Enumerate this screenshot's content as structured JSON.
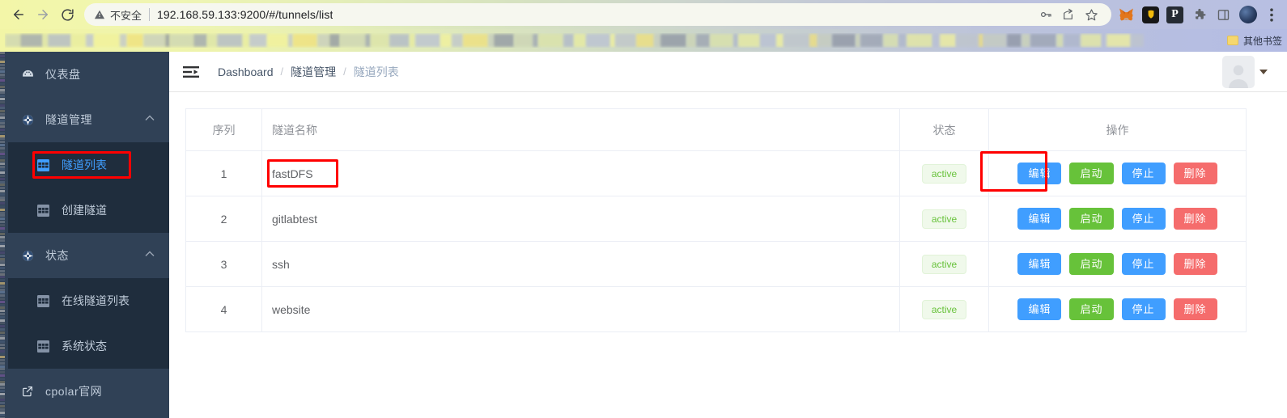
{
  "browser": {
    "back_icon": "back-arrow-icon",
    "forward_icon": "forward-arrow-icon",
    "reload_icon": "reload-icon",
    "security_label": "不安全",
    "warning_icon": "warning-triangle-icon",
    "url": "192.168.59.133:9200/#/tunnels/list",
    "omnibox_icons": [
      "key-icon",
      "share-icon",
      "bookmark-star-icon"
    ],
    "extensions": [
      {
        "name": "metamask-extension-icon",
        "glyph": "🦊"
      },
      {
        "name": "binance-wallet-extension-icon",
        "glyph": "🦁"
      },
      {
        "name": "pocket-extension-icon",
        "glyph": "P"
      },
      {
        "name": "extensions-puzzle-icon",
        "glyph": "puzzle"
      },
      {
        "name": "side-panel-icon",
        "glyph": "panel"
      },
      {
        "name": "profile-avatar-icon",
        "glyph": "avatar"
      },
      {
        "name": "chrome-menu-icon",
        "glyph": "⋮"
      }
    ],
    "other_bookmarks_label": "其他书签"
  },
  "sidebar": {
    "items": [
      {
        "label": "仪表盘",
        "icon": "dashboard-gauge-icon",
        "type": "item"
      },
      {
        "label": "隧道管理",
        "icon": "compass-icon",
        "type": "group",
        "arrow": "chevron-up-icon",
        "children": [
          {
            "label": "隧道列表",
            "icon": "grid-table-icon",
            "active": true,
            "annotated": true
          },
          {
            "label": "创建隧道",
            "icon": "grid-table-icon",
            "active": false
          }
        ]
      },
      {
        "label": "状态",
        "icon": "compass-icon",
        "type": "group",
        "arrow": "chevron-up-icon",
        "children": [
          {
            "label": "在线隧道列表",
            "icon": "grid-table-icon",
            "active": false
          },
          {
            "label": "系统状态",
            "icon": "grid-table-icon",
            "active": false
          }
        ]
      },
      {
        "label": "cpolar官网",
        "icon": "external-link-icon",
        "type": "link"
      }
    ]
  },
  "navbar": {
    "hamburger_icon": "collapse-menu-icon",
    "breadcrumb": [
      "Dashboard",
      "隧道管理",
      "隧道列表"
    ],
    "breadcrumb_separator": "/",
    "avatar_icon": "user-avatar-icon",
    "caret_icon": "caret-down-icon"
  },
  "table": {
    "columns": [
      "序列",
      "隧道名称",
      "状态",
      "操作"
    ],
    "rows": [
      {
        "index": "1",
        "name": "fastDFS",
        "status": "active",
        "name_annotated": true,
        "edit_annotated": true
      },
      {
        "index": "2",
        "name": "gitlabtest",
        "status": "active",
        "name_annotated": false,
        "edit_annotated": false
      },
      {
        "index": "3",
        "name": "ssh",
        "status": "active",
        "name_annotated": false,
        "edit_annotated": false
      },
      {
        "index": "4",
        "name": "website",
        "status": "active",
        "name_annotated": false,
        "edit_annotated": false
      }
    ],
    "actions": {
      "edit": "编辑",
      "start": "启动",
      "stop": "停止",
      "delete": "删除"
    }
  },
  "colors": {
    "sidebar_bg": "#304156",
    "submenu_bg": "#1f2d3d",
    "accent_blue": "#409eff",
    "success_green": "#67c23a",
    "danger_red": "#f56c6c",
    "badge_bg": "#f0f9eb",
    "annotation_red": "#ff0000"
  }
}
